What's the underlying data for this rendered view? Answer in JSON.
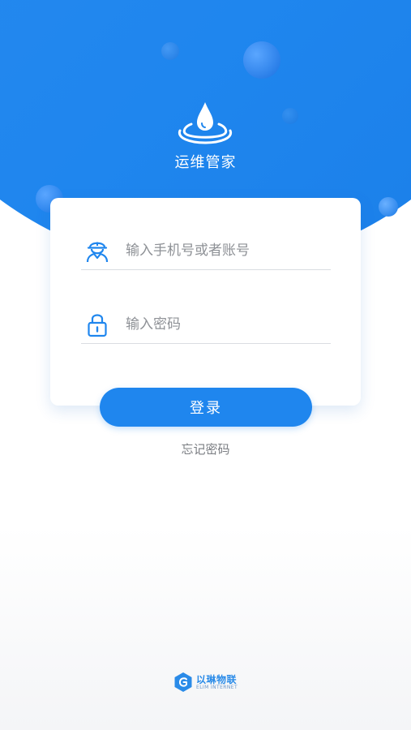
{
  "app": {
    "title": "运维管家"
  },
  "login": {
    "account_placeholder": "输入手机号或者账号",
    "password_placeholder": "输入密码",
    "submit_label": "登录",
    "forgot_label": "忘记密码"
  },
  "footer": {
    "brand_name": "以琳物联",
    "brand_sub": "ELIM INTERNET"
  },
  "icons": {
    "logo": "water-drop-icon",
    "account": "worker-helmet-icon",
    "password": "lock-icon",
    "brand": "brand-logo-icon"
  },
  "colors": {
    "primary": "#1f86ee",
    "card_bg": "#ffffff",
    "placeholder": "#8e9196",
    "link": "#7a7d82"
  }
}
